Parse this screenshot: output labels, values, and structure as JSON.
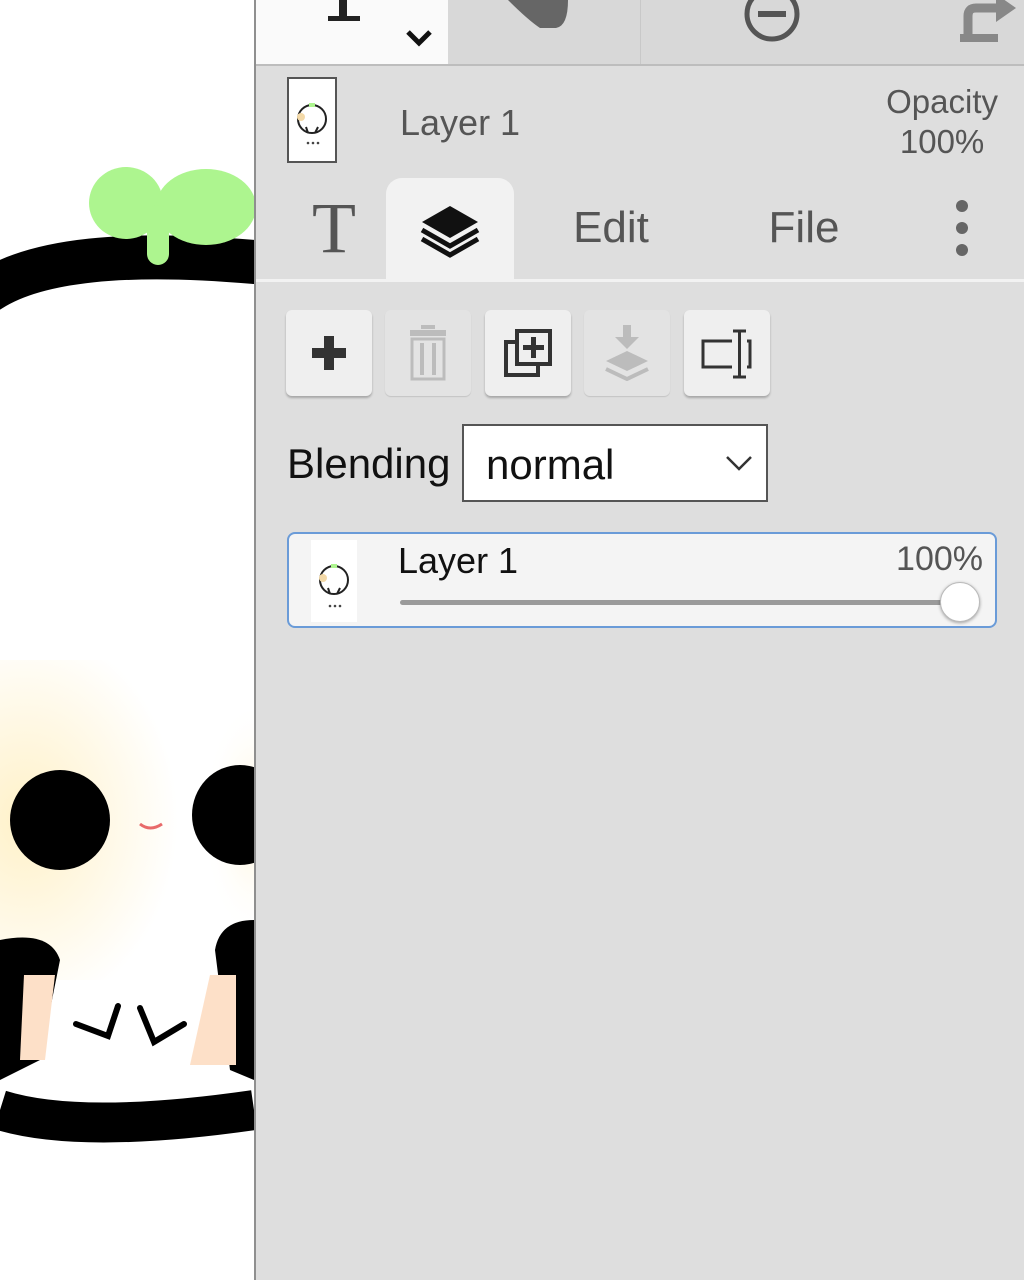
{
  "canvas": {
    "description_icon": "panda-character-artwork"
  },
  "toolbar": {
    "tools": [
      {
        "name": "text-tool",
        "icon": "text-cursor-icon"
      },
      {
        "name": "fill-tool",
        "icon": "paint-bucket-icon"
      },
      {
        "name": "zoom-out",
        "icon": "zoom-out-icon"
      },
      {
        "name": "redo",
        "icon": "redo-icon"
      }
    ]
  },
  "layer_header": {
    "name": "Layer 1",
    "opacity_label": "Opacity",
    "opacity_value": "100%"
  },
  "tabs": {
    "text_icon": "T",
    "layers_icon": "layers-icon",
    "edit": "Edit",
    "file": "File",
    "more_icon": "more-vertical-icon"
  },
  "actions": [
    {
      "name": "add-layer",
      "icon": "plus-icon",
      "enabled": true
    },
    {
      "name": "delete-layer",
      "icon": "trash-icon",
      "enabled": false
    },
    {
      "name": "duplicate-layer",
      "icon": "duplicate-icon",
      "enabled": true
    },
    {
      "name": "merge-down",
      "icon": "merge-down-icon",
      "enabled": false
    },
    {
      "name": "rename-layer",
      "icon": "rename-icon",
      "enabled": true
    }
  ],
  "blending": {
    "label": "Blending",
    "value": "normal"
  },
  "layers": [
    {
      "name": "Layer 1",
      "opacity": "100%",
      "opacity_fraction": 1.0,
      "selected": true
    }
  ],
  "colors": {
    "panel_bg": "#dedede",
    "selection_border": "#6a9bd8",
    "sprout_green": "#adf58f"
  }
}
